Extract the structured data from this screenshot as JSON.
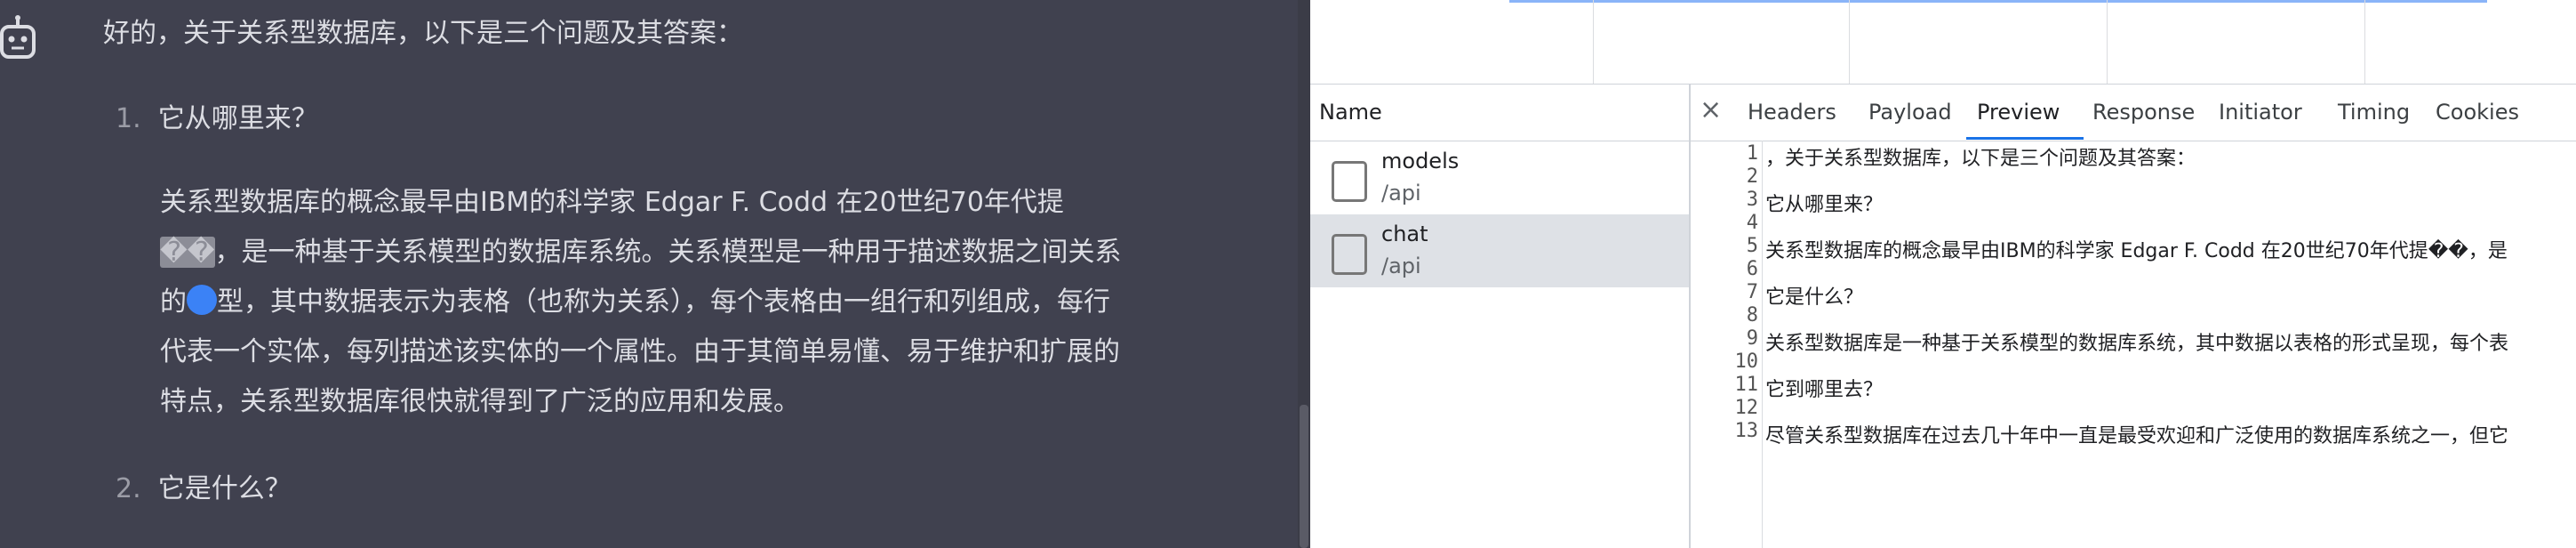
{
  "chat": {
    "intro": "好的，关于关系型数据库，以下是三个问题及其答案：",
    "q1_num": "1.",
    "q1": "它从哪里来？",
    "para_lines": [
      "关系型数据库的概念最早由IBM的科学家 Edgar F. Codd 在20世纪70年代提",
      "，是一种基于关系模型的数据库系统。关系模型是一种用于描述数据之间关系",
      "的",
      "型，其中数据表示为表格（也称为关系），每个表格由一组行和列组成，每行",
      "代表一个实体，每列描述该实体的一个属性。由于其简单易懂、易于维护和扩展的",
      "特点，关系型数据库很快就得到了广泛的应用和发展。"
    ],
    "garbled": "��",
    "q2_num": "2.",
    "q2": "它是什么？"
  },
  "network": {
    "name_header": "Name",
    "requests": [
      {
        "name": "models",
        "path": "/api"
      },
      {
        "name": "chat",
        "path": "/api"
      }
    ],
    "tabs": [
      "Headers",
      "Payload",
      "Preview",
      "Response",
      "Initiator",
      "Timing",
      "Cookies"
    ],
    "active_tab": "Preview",
    "close": "×",
    "preview_lines": [
      {
        "n": "1",
        "text": "，关于关系型数据库，以下是三个问题及其答案："
      },
      {
        "n": "2",
        "text": ""
      },
      {
        "n": "3",
        "text": "它从哪里来？"
      },
      {
        "n": "4",
        "text": ""
      },
      {
        "n": "5",
        "text": "关系型数据库的概念最早由IBM的科学家 Edgar F. Codd 在20世纪70年代提��，是"
      },
      {
        "n": "6",
        "text": ""
      },
      {
        "n": "7",
        "text": "它是什么？"
      },
      {
        "n": "8",
        "text": ""
      },
      {
        "n": "9",
        "text": "关系型数据库是一种基于关系模型的数据库系统，其中数据以表格的形式呈现，每个表"
      },
      {
        "n": "10",
        "text": ""
      },
      {
        "n": "11",
        "text": "它到哪里去？"
      },
      {
        "n": "12",
        "text": ""
      },
      {
        "n": "13",
        "text": "尽管关系型数据库在过去几十年中一直是最受欢迎和广泛使用的数据库系统之一，但它"
      }
    ]
  },
  "icons": {
    "assistant": "robot-icon",
    "close": "close-icon",
    "checkbox": "checkbox-icon"
  }
}
